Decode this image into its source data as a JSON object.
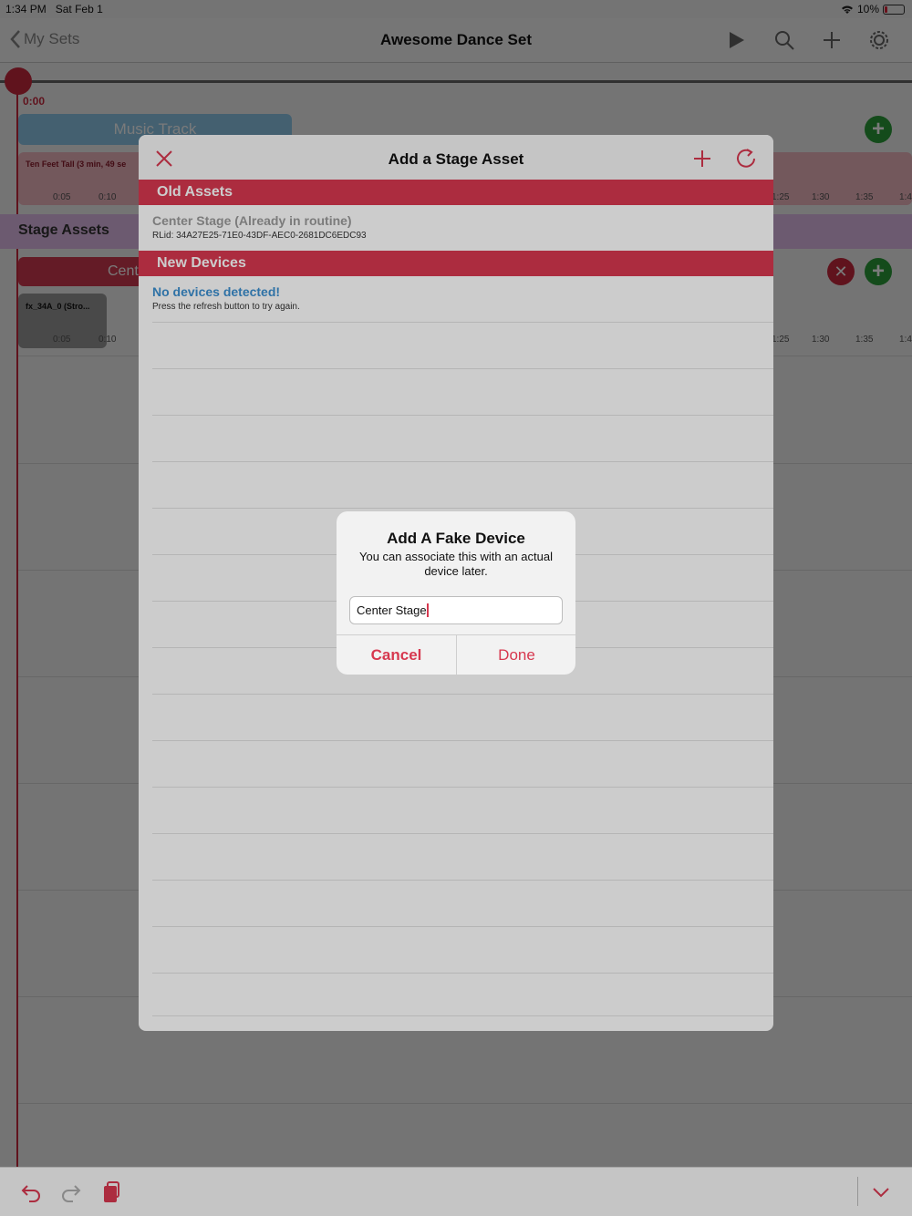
{
  "status_bar": {
    "time": "1:34 PM",
    "date": "Sat Feb 1",
    "battery": "10%",
    "wifi_icon": "wifi-icon"
  },
  "nav": {
    "back_label": "My Sets",
    "title": "Awesome Dance Set",
    "icons": [
      "play-icon",
      "search-icon",
      "plus-icon",
      "gear-icon"
    ]
  },
  "timeline": {
    "playhead_time": "0:00",
    "music_track_label": "Music Track",
    "song_label": "Ten Feet Tall (3 min, 49 se",
    "ticks_left": [
      "0:05",
      "0:10"
    ],
    "ticks_right": [
      "1:25",
      "1:30",
      "1:35",
      "1:4"
    ],
    "stage_assets_label": "Stage Assets",
    "center_pill_label": "Cent",
    "fx_label": "fx_34A_0 (Stro...",
    "accent": "#c8283f",
    "add_color": "#2a9d3a"
  },
  "sheet": {
    "title": "Add a Stage Asset",
    "sections": {
      "old_assets": "Old Assets",
      "new_devices": "New Devices"
    },
    "old_asset": {
      "title": "Center Stage (Already in routine)",
      "subtitle": "RLid: 34A27E25-71E0-43DF-AEC0-2681DC6EDC93"
    },
    "new_device": {
      "title": "No devices detected!",
      "subtitle": "Press the refresh button to try again."
    },
    "header_color": "#d7384f"
  },
  "alert": {
    "title": "Add A Fake Device",
    "message": "You can associate this with an actual device later.",
    "input_value": "Center Stage",
    "cancel_label": "Cancel",
    "done_label": "Done"
  },
  "bottom_bar": {
    "icons": [
      "undo-icon",
      "redo-icon",
      "copy-icon",
      "chevron-down-icon"
    ]
  }
}
